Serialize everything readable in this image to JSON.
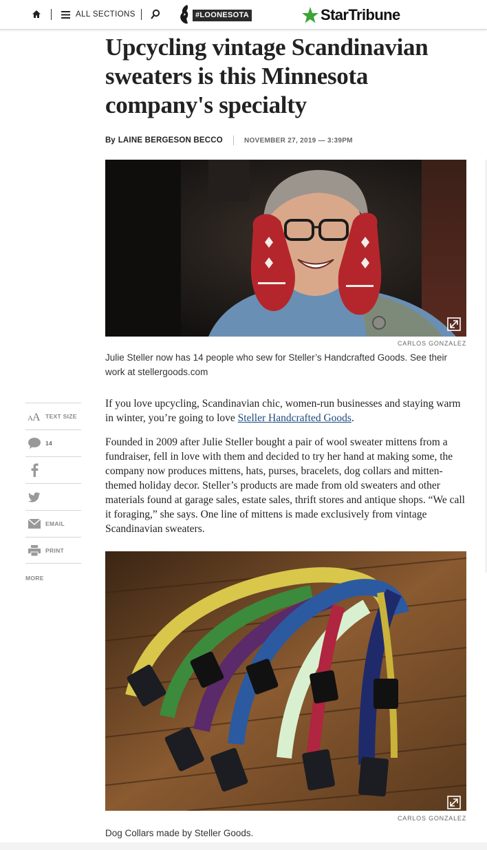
{
  "topbar": {
    "all_sections_label": "ALL SECTIONS",
    "loonesota_label": "#LOONESOTA",
    "logo_text": "StarTribune",
    "logo_star_color": "#3aa637"
  },
  "article": {
    "headline": "Upcycling vintage Scandinavian sweaters is this Minnesota company's specialty",
    "by_label": "By",
    "author": "LAINE BERGESON BECCO",
    "date": "NOVEMBER 27, 2019 — 3:39PM",
    "photo1": {
      "credit": "CARLOS GONZALEZ",
      "caption": "Julie Steller now has 14 people who sew for Steller’s Handcrafted Goods. See their work at stellergoods.com"
    },
    "para1_before": "If you love upcycling, Scandinavian chic, women-run businesses and staying warm in winter, you’re going to love ",
    "para1_link": "Steller Handcrafted Goods",
    "para1_after": ".",
    "para2": "Founded in 2009 after Julie Steller bought a pair of wool sweater mittens from a fundraiser, fell in love with them and decided to try her hand at making some, the company now produces mittens, hats, purses, bracelets, dog collars and mitten-themed holiday decor. Steller’s products are made from old sweaters and other materials found at garage sales, estate sales, thrift stores and antique shops. “We call it foraging,” she says. One line of mittens is made exclusively from vintage Scandinavian sweaters.",
    "photo2": {
      "credit": "CARLOS GONZALEZ",
      "caption": "Dog Collars made by Steller Goods."
    }
  },
  "share_rail": {
    "text_size_label": "TEXT SIZE",
    "comments_count": "14",
    "email_label": "EMAIL",
    "print_label": "PRINT",
    "more_label": "MORE"
  }
}
